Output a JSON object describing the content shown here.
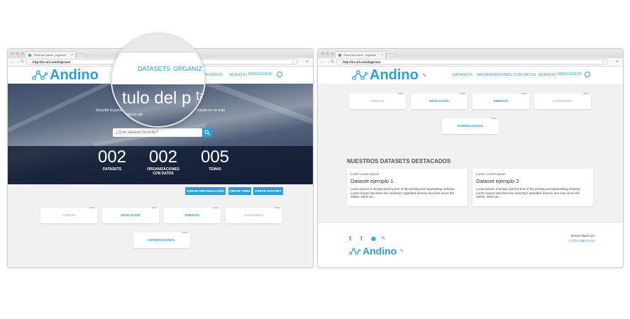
{
  "browser": {
    "tab_title": "Título del portal - Ingresar",
    "url": "http://tu-url.com/ingresar"
  },
  "brand": {
    "name": "Andino",
    "accent_color": "#2a9fd6"
  },
  "nav": {
    "datasets": "DATASETS",
    "organizaciones": "ORGANIZACIONES CON DATOS",
    "organizaciones_short": "ORGANIZ",
    "acerca": "ACERCA",
    "user": "MERCEDESF"
  },
  "hero": {
    "title": "Título del portal",
    "magnified_title": "tulo del p",
    "magnified_title_tail": "tal",
    "description": "Describí el portal. Explicá de qué se trata tu catálogo. Por favor, hacelo en no más",
    "magnified_description": "e trata tu cat",
    "search_placeholder": "¿Qué dataset buscás?",
    "search_icon": "search-icon"
  },
  "stats": [
    {
      "value": "002",
      "label_line1": "DATASETS",
      "label_line2": ""
    },
    {
      "value": "002",
      "label_line1": "ORGANIZACIONES",
      "label_line2": "CON DATOS"
    },
    {
      "value": "005",
      "label_line1": "TEMAS",
      "label_line2": ""
    }
  ],
  "actions": {
    "create_org": "CREAR ORGANIZACIÓN",
    "create_topic": "CREAR TEMA",
    "create_dataset": "CREAR DATASET"
  },
  "topics": [
    "CIENCIA",
    "EDUCACIÓN",
    "ENERGÍA",
    "GANADERÍA",
    "INTERNACIONAL"
  ],
  "featured": {
    "title": "NUESTROS DATASETS DESTACADOS",
    "cards": [
      {
        "small": "Lorem Lorem Ipsum",
        "title": "Dataset ejemplo 1",
        "text": "Lorem Ipsum is simply dummy text of the printing and typesetting industry. Lorem Ipsum has been the industry's standard dummy text ever since the 1500s, when an..."
      },
      {
        "small": "Lorem, Lorem Ipsum",
        "title": "Dataset ejemplo 2",
        "text": "Lorem Ipsum is simply dummy text of the printing and typesetting industry. Lorem Ipsum has been the industry's standard dummy text ever since the 1500s, when an..."
      }
    ]
  },
  "footer": {
    "developed_by": "Desarrollado por",
    "andino": "Andino",
    "con": "con",
    "ckan": "CKAN",
    "social_icons": [
      "twitter-icon",
      "facebook-icon",
      "github-icon",
      "pencil-icon"
    ]
  }
}
